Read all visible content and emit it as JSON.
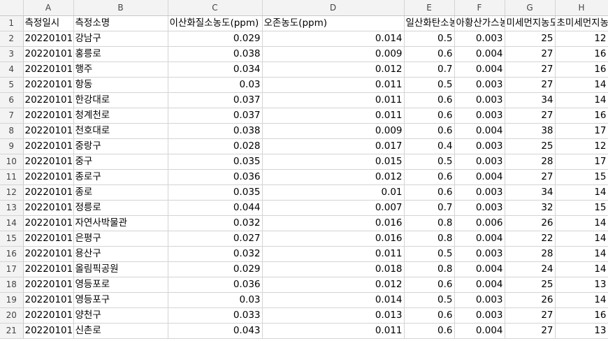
{
  "columns": [
    "A",
    "B",
    "C",
    "D",
    "E",
    "F",
    "G",
    "H"
  ],
  "header_row": {
    "row_number": "1",
    "cells": [
      "측정일시",
      "측정소명",
      "이산화질소농도(ppm)",
      "오존농도(ppm)",
      "일산화탄소농도(ppm)",
      "아황산가스농도(ppm)",
      "미세먼지농도",
      "초미세먼지농도"
    ]
  },
  "rows": [
    {
      "n": "2",
      "c": [
        "20220101",
        "강남구",
        "0.029",
        "0.014",
        "0.5",
        "0.003",
        "25",
        "12"
      ]
    },
    {
      "n": "3",
      "c": [
        "20220101",
        "홍릉로",
        "0.038",
        "0.009",
        "0.6",
        "0.004",
        "27",
        "16"
      ]
    },
    {
      "n": "4",
      "c": [
        "20220101",
        "행주",
        "0.034",
        "0.012",
        "0.7",
        "0.004",
        "27",
        "16"
      ]
    },
    {
      "n": "5",
      "c": [
        "20220101",
        "항동",
        "0.03",
        "0.011",
        "0.5",
        "0.003",
        "27",
        "14"
      ]
    },
    {
      "n": "6",
      "c": [
        "20220101",
        "한강대로",
        "0.037",
        "0.011",
        "0.6",
        "0.003",
        "34",
        "14"
      ]
    },
    {
      "n": "7",
      "c": [
        "20220101",
        "청계천로",
        "0.037",
        "0.011",
        "0.6",
        "0.003",
        "27",
        "16"
      ]
    },
    {
      "n": "8",
      "c": [
        "20220101",
        "천호대로",
        "0.038",
        "0.009",
        "0.6",
        "0.004",
        "38",
        "17"
      ]
    },
    {
      "n": "9",
      "c": [
        "20220101",
        "중랑구",
        "0.028",
        "0.017",
        "0.4",
        "0.003",
        "25",
        "12"
      ]
    },
    {
      "n": "10",
      "c": [
        "20220101",
        "중구",
        "0.035",
        "0.015",
        "0.5",
        "0.003",
        "28",
        "17"
      ]
    },
    {
      "n": "11",
      "c": [
        "20220101",
        "종로구",
        "0.036",
        "0.012",
        "0.6",
        "0.004",
        "27",
        "15"
      ]
    },
    {
      "n": "12",
      "c": [
        "20220101",
        "종로",
        "0.035",
        "0.01",
        "0.6",
        "0.003",
        "34",
        "14"
      ]
    },
    {
      "n": "13",
      "c": [
        "20220101",
        "정릉로",
        "0.044",
        "0.007",
        "0.7",
        "0.003",
        "32",
        "15"
      ]
    },
    {
      "n": "14",
      "c": [
        "20220101",
        "자연사박물관",
        "0.032",
        "0.016",
        "0.8",
        "0.006",
        "26",
        "14"
      ]
    },
    {
      "n": "15",
      "c": [
        "20220101",
        "은평구",
        "0.027",
        "0.016",
        "0.8",
        "0.004",
        "22",
        "14"
      ]
    },
    {
      "n": "16",
      "c": [
        "20220101",
        "용산구",
        "0.032",
        "0.011",
        "0.5",
        "0.003",
        "28",
        "14"
      ]
    },
    {
      "n": "17",
      "c": [
        "20220101",
        "올림픽공원",
        "0.029",
        "0.018",
        "0.8",
        "0.004",
        "24",
        "14"
      ]
    },
    {
      "n": "18",
      "c": [
        "20220101",
        "영등포로",
        "0.036",
        "0.012",
        "0.6",
        "0.004",
        "25",
        "13"
      ]
    },
    {
      "n": "19",
      "c": [
        "20220101",
        "영등포구",
        "0.03",
        "0.014",
        "0.5",
        "0.003",
        "26",
        "14"
      ]
    },
    {
      "n": "20",
      "c": [
        "20220101",
        "양천구",
        "0.033",
        "0.013",
        "0.6",
        "0.003",
        "27",
        "16"
      ]
    },
    {
      "n": "21",
      "c": [
        "20220101",
        "신촌로",
        "0.043",
        "0.011",
        "0.6",
        "0.004",
        "27",
        "13"
      ]
    }
  ]
}
